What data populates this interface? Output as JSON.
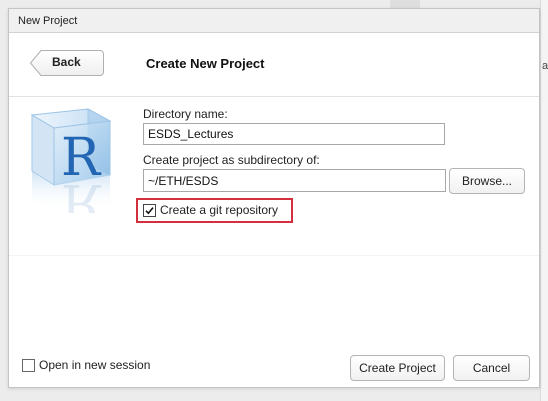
{
  "window": {
    "title": "New Project"
  },
  "header": {
    "back_label": "Back",
    "page_title": "Create New Project"
  },
  "form": {
    "directory_label": "Directory name:",
    "directory_value": "ESDS_Lectures",
    "parent_label": "Create project as subdirectory of:",
    "parent_value": "~/ETH/ESDS",
    "browse_label": "Browse...",
    "git_label": "Create a git repository",
    "git_checked": true
  },
  "footer": {
    "new_session_label": "Open in new session",
    "new_session_checked": false,
    "create_label": "Create Project",
    "cancel_label": "Cancel"
  },
  "colors": {
    "highlight": "#d32f3f",
    "logo_blue": "#6fa8dc",
    "logo_letter": "#2266b3"
  },
  "background": {
    "peek_text": "ag"
  }
}
